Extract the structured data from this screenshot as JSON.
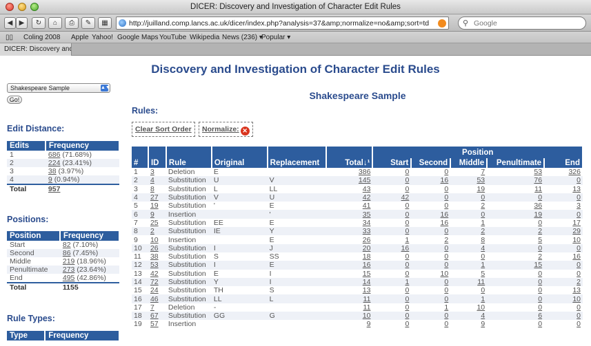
{
  "window": {
    "title": "DICER: Discovery and Investigation of Character Edit Rules"
  },
  "toolbar": {
    "url": "http://juilland.comp.lancs.ac.uk/dicer/index.php?analysis=37&amp;normalize=no&amp;sort=td",
    "search_placeholder": "Google"
  },
  "bookmarks": [
    "Coling 2008",
    "Apple",
    "Yahoo!",
    "Google Maps",
    "YouTube",
    "Wikipedia",
    "News (236) ▾",
    "Popular ▾"
  ],
  "tab": {
    "label": "DICER: Discovery and Inve..."
  },
  "page": {
    "title": "Discovery and Investigation of Character Edit Rules",
    "sample_select": "Shakespeare Sample",
    "go_label": "Go!",
    "main_title": "Shakespeare Sample",
    "rules_title": "Rules:",
    "clear_sort": "Clear Sort Order",
    "normalize": "Normalize:"
  },
  "edit_distance": {
    "title": "Edit Distance:",
    "headers": [
      "Edits",
      "Frequency"
    ],
    "rows": [
      {
        "k": "1",
        "v": "686",
        "p": "(71.68%)"
      },
      {
        "k": "2",
        "v": "224",
        "p": "(23.41%)"
      },
      {
        "k": "3",
        "v": "38",
        "p": "(3.97%)"
      },
      {
        "k": "4",
        "v": "9",
        "p": "(0.94%)"
      }
    ],
    "total_label": "Total",
    "total": "957"
  },
  "positions": {
    "title": "Positions:",
    "headers": [
      "Position",
      "Frequency"
    ],
    "rows": [
      {
        "k": "Start",
        "v": "82",
        "p": "(7.10%)"
      },
      {
        "k": "Second",
        "v": "86",
        "p": "(7.45%)"
      },
      {
        "k": "Middle",
        "v": "219",
        "p": "(18.96%)"
      },
      {
        "k": "Penultimate",
        "v": "273",
        "p": "(23.64%)"
      },
      {
        "k": "End",
        "v": "495",
        "p": "(42.86%)"
      }
    ],
    "total_label": "Total",
    "total": "1155"
  },
  "rule_types": {
    "title": "Rule Types:",
    "headers": [
      "Type",
      "Frequency"
    ]
  },
  "rules_table": {
    "headers": {
      "num": "#",
      "id": "ID",
      "rule": "Rule",
      "original": "Original",
      "replacement": "Replacement",
      "total": "Total↓¹",
      "position": "Position",
      "start": "Start",
      "second": "Second",
      "middle": "Middle",
      "penultimate": "Penultimate",
      "end": "End"
    },
    "rows": [
      [
        "1",
        "3",
        "Deletion",
        "E",
        "",
        "386",
        "0",
        "0",
        "7",
        "53",
        "326"
      ],
      [
        "2",
        "4",
        "Substitution",
        "U",
        "V",
        "145",
        "0",
        "16",
        "53",
        "76",
        "0"
      ],
      [
        "3",
        "8",
        "Substitution",
        "L",
        "LL",
        "43",
        "0",
        "0",
        "19",
        "11",
        "13"
      ],
      [
        "4",
        "27",
        "Substitution",
        "V",
        "U",
        "42",
        "42",
        "0",
        "0",
        "0",
        "0"
      ],
      [
        "5",
        "19",
        "Substitution",
        "'",
        "E",
        "41",
        "0",
        "0",
        "2",
        "36",
        "3"
      ],
      [
        "6",
        "9",
        "Insertion",
        "",
        "'",
        "35",
        "0",
        "16",
        "0",
        "19",
        "0"
      ],
      [
        "7",
        "25",
        "Substitution",
        "EE",
        "E",
        "34",
        "0",
        "16",
        "1",
        "0",
        "17"
      ],
      [
        "8",
        "2",
        "Substitution",
        "IE",
        "Y",
        "33",
        "0",
        "0",
        "2",
        "2",
        "29"
      ],
      [
        "9",
        "10",
        "Insertion",
        "",
        "E",
        "26",
        "1",
        "2",
        "8",
        "5",
        "10"
      ],
      [
        "10",
        "26",
        "Substitution",
        "I",
        "J",
        "20",
        "16",
        "0",
        "4",
        "0",
        "0"
      ],
      [
        "11",
        "38",
        "Substitution",
        "S",
        "SS",
        "18",
        "0",
        "0",
        "0",
        "2",
        "16"
      ],
      [
        "12",
        "53",
        "Substitution",
        "I",
        "E",
        "16",
        "0",
        "0",
        "1",
        "15",
        "0"
      ],
      [
        "13",
        "42",
        "Substitution",
        "E",
        "I",
        "15",
        "0",
        "10",
        "5",
        "0",
        "0"
      ],
      [
        "14",
        "72",
        "Substitution",
        "Y",
        "I",
        "14",
        "1",
        "0",
        "11",
        "0",
        "2"
      ],
      [
        "15",
        "24",
        "Substitution",
        "TH",
        "S",
        "13",
        "0",
        "0",
        "0",
        "0",
        "13"
      ],
      [
        "16",
        "46",
        "Substitution",
        "LL",
        "L",
        "11",
        "0",
        "0",
        "1",
        "0",
        "10"
      ],
      [
        "17",
        "7",
        "Deletion",
        "-",
        "",
        "11",
        "0",
        "1",
        "10",
        "0",
        "0"
      ],
      [
        "18",
        "67",
        "Substitution",
        "GG",
        "G",
        "10",
        "0",
        "0",
        "4",
        "6",
        "0"
      ],
      [
        "19",
        "57",
        "Insertion",
        "",
        "",
        "9",
        "0",
        "0",
        "9",
        "0",
        "0"
      ]
    ]
  }
}
